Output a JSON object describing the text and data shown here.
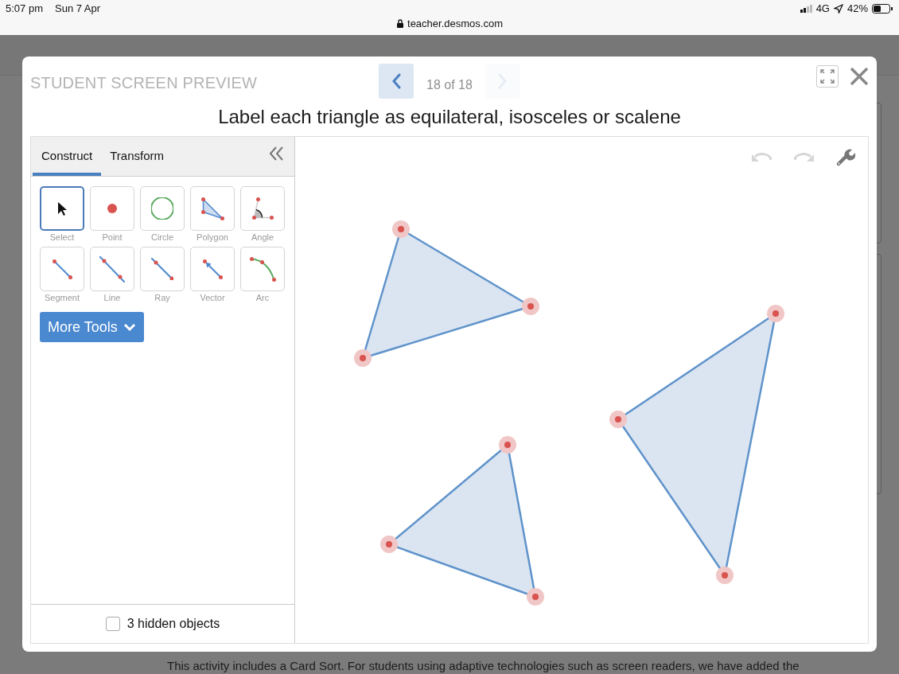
{
  "status_bar": {
    "time": "5:07 pm",
    "date": "Sun 7 Apr",
    "url": "teacher.desmos.com",
    "network": "4G",
    "battery": "42%"
  },
  "background_page": {
    "notice": "This activity includes a Card Sort. For students using adaptive technologies such as screen readers, we have added the"
  },
  "modal": {
    "title": "STUDENT SCREEN PREVIEW",
    "previous_disabled": false,
    "next_disabled": true,
    "position": "18 of 18",
    "prompt": "Label each triangle as equilateral, isosceles or scalene",
    "tool_panel": {
      "tabs": [
        {
          "label": "Construct",
          "selected": true
        },
        {
          "label": "Transform",
          "selected": false
        }
      ],
      "tools": [
        {
          "label": "Select",
          "kind": "select",
          "selected": true
        },
        {
          "label": "Point",
          "kind": "point",
          "selected": false
        },
        {
          "label": "Circle",
          "kind": "circle",
          "selected": false
        },
        {
          "label": "Polygon",
          "kind": "polygon",
          "selected": false
        },
        {
          "label": "Angle",
          "kind": "angle",
          "selected": false
        },
        {
          "label": "Segment",
          "kind": "segment",
          "selected": false
        },
        {
          "label": "Line",
          "kind": "line",
          "selected": false
        },
        {
          "label": "Ray",
          "kind": "ray",
          "selected": false
        },
        {
          "label": "Vector",
          "kind": "vector",
          "selected": false
        },
        {
          "label": "Arc",
          "kind": "arc",
          "selected": false
        }
      ],
      "more_button": "More Tools",
      "hidden_objects": {
        "label": "3 hidden objects",
        "checked": false
      }
    },
    "canvas": {
      "undo_disabled": true,
      "redo_disabled": true
    }
  }
}
